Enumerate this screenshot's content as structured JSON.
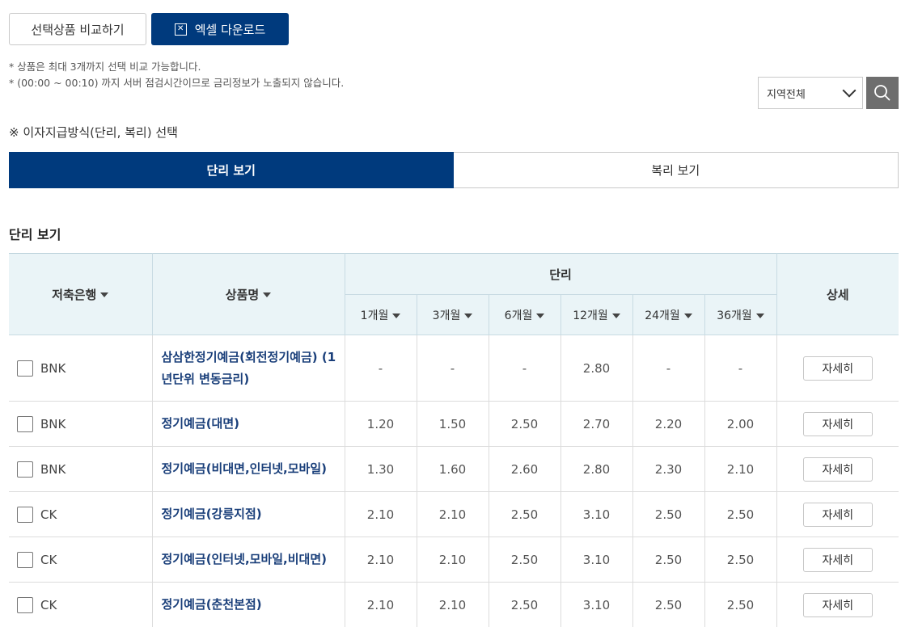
{
  "top_buttons": {
    "compare_label": "선택상품 비교하기",
    "excel_label": "엑셀 다운로드",
    "excel_icon": "excel-icon"
  },
  "notes": [
    "* 상품은 최대 3개까지 선택 비교 가능합니다.",
    "* (00:00 ~ 00:10) 까지 서버 점검시간이므로 금리정보가 노출되지 않습니다."
  ],
  "region_select": {
    "value": "지역전체",
    "icon": "chevron-down-icon"
  },
  "search": {
    "icon": "search-icon"
  },
  "method_label": "※ 이자지급방식(단리, 복리) 선택",
  "tabs": [
    {
      "label": "단리 보기",
      "active": true
    },
    {
      "label": "복리 보기",
      "active": false
    }
  ],
  "section_title": "단리 보기",
  "table": {
    "headers": {
      "bank": "저축은행",
      "product": "상품명",
      "rate_group": "단리",
      "detail": "상세",
      "periods": [
        "1개월",
        "3개월",
        "6개월",
        "12개월",
        "24개월",
        "36개월"
      ]
    },
    "detail_label": "자세히",
    "rows": [
      {
        "bank": "BNK",
        "product": "삼삼한정기예금(회전정기예금) (1년단위 변동금리)",
        "rates": [
          "-",
          "-",
          "-",
          "2.80",
          "-",
          "-"
        ]
      },
      {
        "bank": "BNK",
        "product": "정기예금(대면)",
        "rates": [
          "1.20",
          "1.50",
          "2.50",
          "2.70",
          "2.20",
          "2.00"
        ]
      },
      {
        "bank": "BNK",
        "product": "정기예금(비대면,인터넷,모바일)",
        "rates": [
          "1.30",
          "1.60",
          "2.60",
          "2.80",
          "2.30",
          "2.10"
        ]
      },
      {
        "bank": "CK",
        "product": "정기예금(강릉지점)",
        "rates": [
          "2.10",
          "2.10",
          "2.50",
          "3.10",
          "2.50",
          "2.50"
        ]
      },
      {
        "bank": "CK",
        "product": "정기예금(인터넷,모바일,비대면)",
        "rates": [
          "2.10",
          "2.10",
          "2.50",
          "3.10",
          "2.50",
          "2.50"
        ]
      },
      {
        "bank": "CK",
        "product": "정기예금(춘천본점)",
        "rates": [
          "2.10",
          "2.10",
          "2.50",
          "3.10",
          "2.50",
          "2.50"
        ]
      }
    ]
  },
  "colors": {
    "primary": "#003a7d",
    "header_bg": "#eaf4f7",
    "link": "#1a3f7a"
  }
}
